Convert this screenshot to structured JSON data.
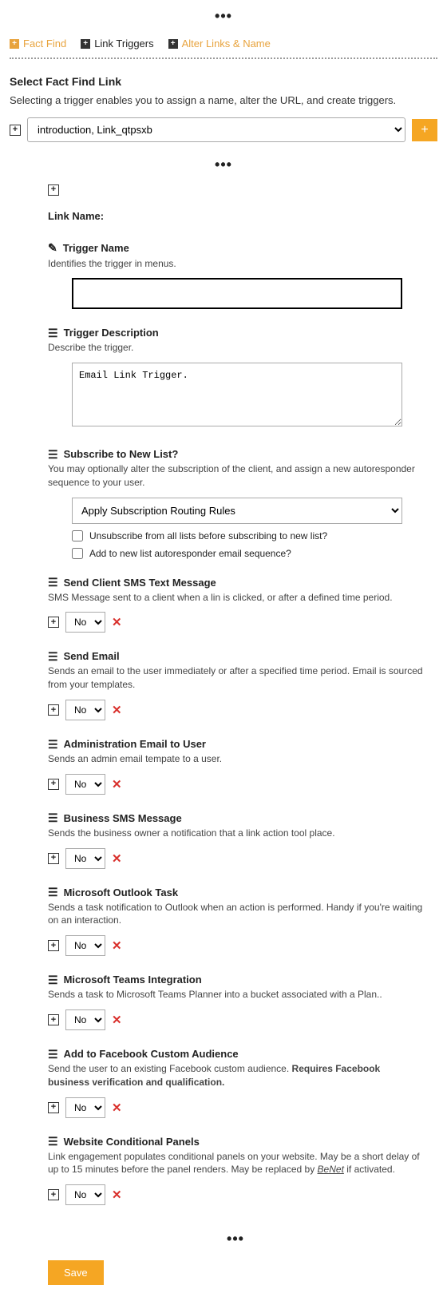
{
  "dots": "•••",
  "tabs": {
    "fact_find": "Fact Find",
    "link_triggers": "Link Triggers",
    "alter_links": "Alter Links & Name"
  },
  "select_link": {
    "heading": "Select Fact Find Link",
    "desc": "Selecting a trigger enables you to assign a name, alter the URL, and create triggers.",
    "option": "introduction, Link_qtpsxb"
  },
  "link_name_label": "Link Name:",
  "trigger_name": {
    "title": "Trigger Name",
    "desc": "Identifies the trigger in menus.",
    "value": ""
  },
  "trigger_desc": {
    "title": "Trigger Description",
    "desc": "Describe the trigger.",
    "value": "Email Link Trigger."
  },
  "subscribe": {
    "title": "Subscribe to New List?",
    "desc": "You may optionally alter the subscription of the client, and assign a new autoresponder sequence to your user.",
    "option": "Apply Subscription Routing Rules",
    "check1": "Unsubscribe from all lists before subscribing to new list?",
    "check2": "Add to new list autoresponder email sequence?"
  },
  "actions": {
    "sms": {
      "title": "Send Client SMS Text Message",
      "desc": "SMS Message sent to a client when a lin is clicked, or after a defined time period.",
      "val": "No"
    },
    "email": {
      "title": "Send Email",
      "desc": "Sends an email to the user immediately or after a specified time period. Email is sourced from your templates.",
      "val": "No"
    },
    "admin": {
      "title": "Administration Email to User",
      "desc": "Sends an admin email tempate to a user.",
      "val": "No"
    },
    "bsms": {
      "title": "Business SMS Message",
      "desc": "Sends the business owner a notification that a link action tool place.",
      "val": "No"
    },
    "outlook": {
      "title": "Microsoft Outlook Task",
      "desc": "Sends a task notification to Outlook when an action is performed. Handy if you're waiting on an interaction.",
      "val": "No"
    },
    "teams": {
      "title": "Microsoft Teams Integration",
      "desc": "Sends a task to Microsoft Teams Planner into a bucket associated with a Plan..",
      "val": "No"
    },
    "fb": {
      "title": "Add to Facebook Custom Audience",
      "desc_pre": "Send the user to an existing Facebook custom audience. ",
      "desc_bold": "Requires Facebook business verification and qualification.",
      "val": "No"
    },
    "website": {
      "title": "Website Conditional Panels",
      "desc_pre": "Link engagement populates conditional panels on your website. May be a short delay of up to 15 minutes before the panel renders. May be replaced by ",
      "benet": "BeNet",
      "desc_post": " if activated.",
      "val": "No"
    }
  },
  "save": "Save"
}
